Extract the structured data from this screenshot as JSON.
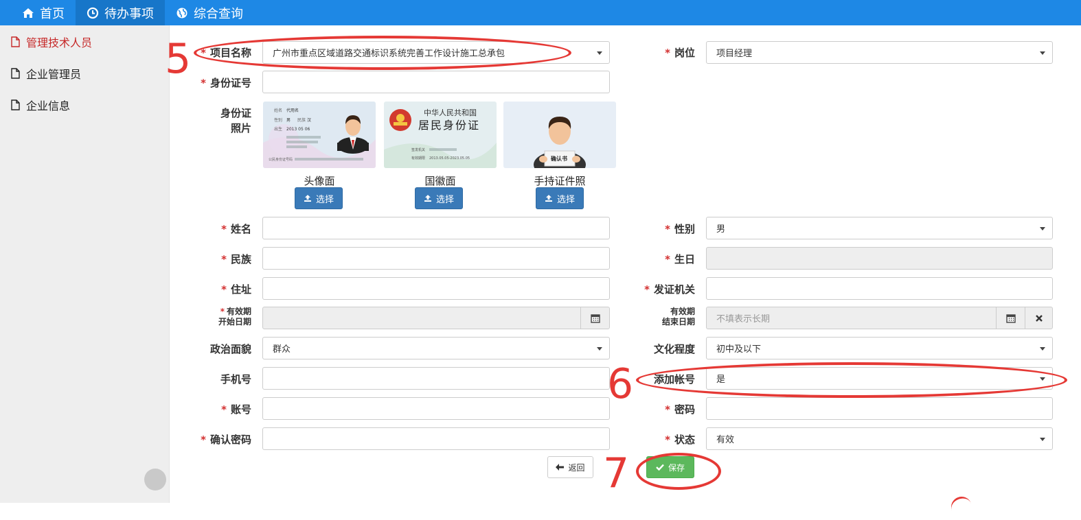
{
  "nav": [
    {
      "label": "首页",
      "icon": "home-icon"
    },
    {
      "label": "待办事项",
      "icon": "clock-icon"
    },
    {
      "label": "综合查询",
      "icon": "globe-icon"
    }
  ],
  "sidebar": [
    {
      "label": "管理技术人员",
      "icon": "document-icon",
      "active": true
    },
    {
      "label": "企业管理员",
      "icon": "document-icon"
    },
    {
      "label": "企业信息",
      "icon": "document-icon"
    }
  ],
  "form": {
    "project_label": "项目名称",
    "project_value": "广州市重点区域道路交通标识系统完善工作设计施工总承包",
    "position_label": "岗位",
    "position_value": "项目经理",
    "idno_label": "身份证号",
    "idno_value": "",
    "idphoto_label_1": "身份证",
    "idphoto_label_2": "照片",
    "photos": [
      {
        "caption": "头像面",
        "button": "选择"
      },
      {
        "caption": "国徽面",
        "button": "选择"
      },
      {
        "caption": "手持证件照",
        "button": "选择"
      }
    ],
    "card": {
      "emblem_title": "中华人民共和国",
      "emblem_subtitle": "居民身份证",
      "name_label": "代用名",
      "gender": "男",
      "nation": "汉",
      "birth": "2013 05 06",
      "issuer_label": "签发机关",
      "validity_label": "有效期限",
      "validity_value": "2013.05.05-2023.05.05",
      "id_label": "公民身份证号码",
      "sign_text": "确认书"
    },
    "name_label": "姓名",
    "gender_label": "性别",
    "gender_value": "男",
    "ethnic_label": "民族",
    "birthday_label": "生日",
    "address_label": "住址",
    "issuer_label": "发证机关",
    "start_label_1": "有效期",
    "start_label_2": "开始日期",
    "end_label_1": "有效期",
    "end_label_2": "结束日期",
    "end_placeholder": "不填表示长期",
    "political_label": "政治面貌",
    "political_value": "群众",
    "education_label": "文化程度",
    "education_value": "初中及以下",
    "phone_label": "手机号",
    "add_account_label": "添加帐号",
    "add_account_value": "是",
    "account_label": "账号",
    "password_label": "密码",
    "confirm_label": "确认密码",
    "status_label": "状态",
    "status_value": "有效",
    "back_button": "返回",
    "save_button": "保存"
  },
  "annotations": [
    "5",
    "6",
    "7"
  ],
  "colors": {
    "nav": "#1e88e5",
    "annotation": "#e53935",
    "save": "#5cb85c",
    "upload": "#3a7ab8",
    "required": "#d32f2f"
  }
}
